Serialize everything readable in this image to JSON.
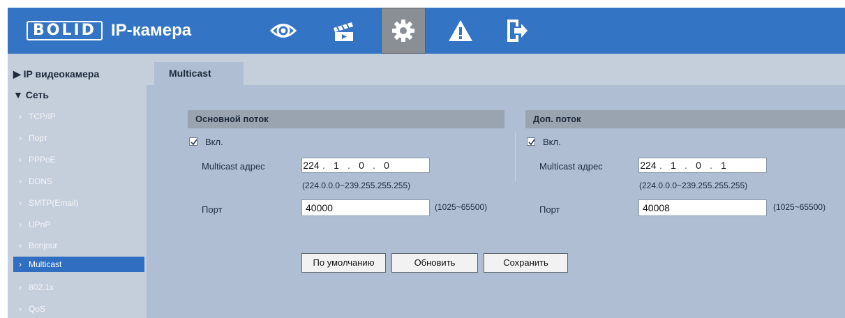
{
  "header": {
    "brand": "BOLID",
    "title": "IP-камера",
    "nav": [
      "eye-icon",
      "clapperboard-icon",
      "gear-icon",
      "warning-icon",
      "logout-icon"
    ],
    "active_nav": "gear-icon",
    "accent_color": "#3474c4"
  },
  "sidebar": {
    "group_ipcam": "▶ IP видеокамера",
    "group_net": "▼ Сеть",
    "items": [
      {
        "label": "TCP/IP"
      },
      {
        "label": "Порт"
      },
      {
        "label": "PPPoE"
      },
      {
        "label": "DDNS"
      },
      {
        "label": "SMTP(Email)"
      },
      {
        "label": "UPnP"
      },
      {
        "label": "Bonjour"
      },
      {
        "label": "Multicast"
      },
      {
        "label": "802.1x"
      },
      {
        "label": "QoS"
      }
    ],
    "active_item": "Multicast"
  },
  "main": {
    "tab": "Multicast",
    "main_stream": {
      "title": "Основной поток",
      "enable_label": "Вкл.",
      "enabled": true,
      "addr_label": "Multicast адрес",
      "addr": [
        "224",
        "1",
        "0",
        "0"
      ],
      "addr_hint": "(224.0.0.0~239.255.255.255)",
      "port_label": "Порт",
      "port": "40000",
      "port_hint": "(1025~65500)"
    },
    "sub_stream": {
      "title": "Доп. поток",
      "enable_label": "Вкл.",
      "enabled": true,
      "addr_label": "Multicast адрес",
      "addr": [
        "224",
        "1",
        "0",
        "1"
      ],
      "addr_hint": "(224.0.0.0~239.255.255.255)",
      "port_label": "Порт",
      "port": "40008",
      "port_hint": "(1025~65500)"
    },
    "buttons": {
      "default": "По умолчанию",
      "refresh": "Обновить",
      "save": "Сохранить"
    }
  }
}
